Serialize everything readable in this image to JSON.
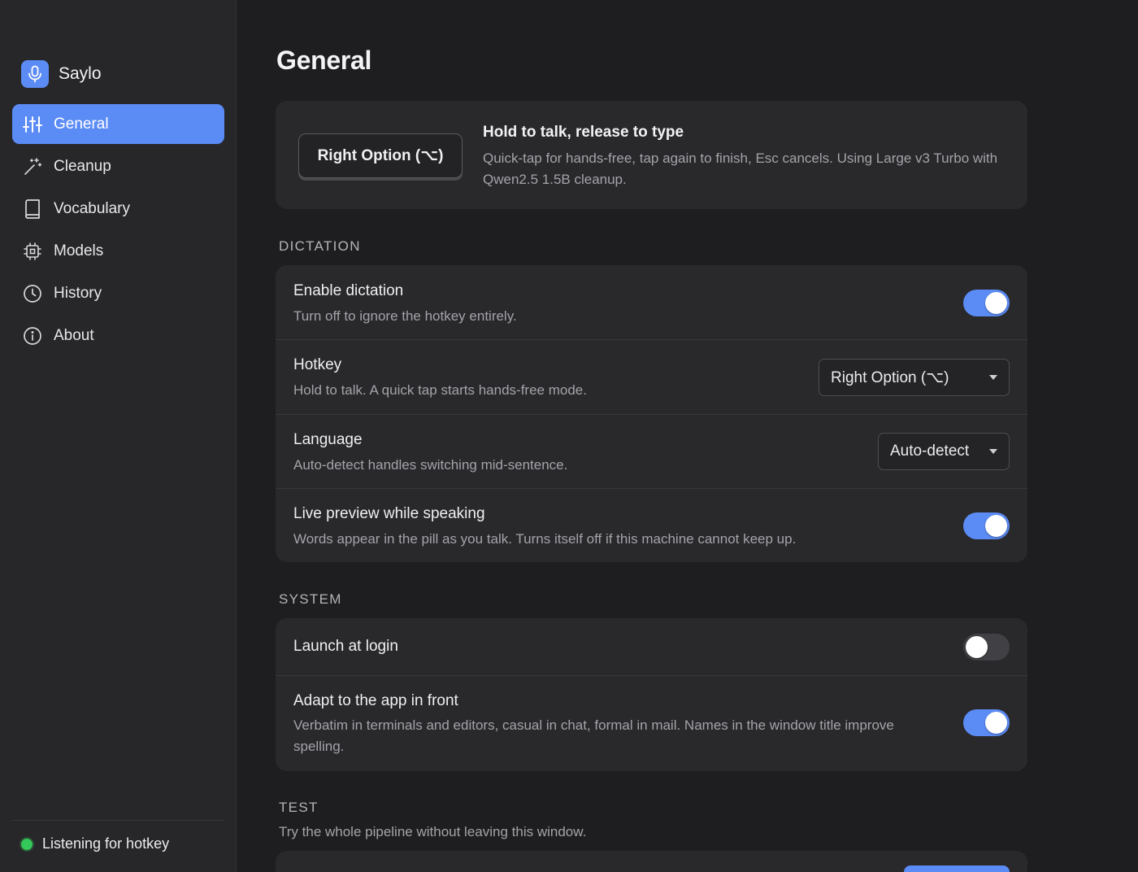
{
  "app": {
    "name": "Saylo"
  },
  "sidebar": {
    "items": [
      {
        "label": "General",
        "icon": "sliders-icon",
        "active": true
      },
      {
        "label": "Cleanup",
        "icon": "magic-wand-icon",
        "active": false
      },
      {
        "label": "Vocabulary",
        "icon": "book-icon",
        "active": false
      },
      {
        "label": "Models",
        "icon": "chip-icon",
        "active": false
      },
      {
        "label": "History",
        "icon": "clock-icon",
        "active": false
      },
      {
        "label": "About",
        "icon": "info-icon",
        "active": false
      }
    ],
    "status": {
      "text": "Listening for hotkey",
      "color": "#34c759"
    }
  },
  "page": {
    "title": "General"
  },
  "hero": {
    "key_label": "Right Option (⌥)",
    "title": "Hold to talk, release to type",
    "description": "Quick-tap for hands-free, tap again to finish, Esc cancels. Using Large v3 Turbo with Qwen2.5 1.5B cleanup."
  },
  "dictation": {
    "heading": "DICTATION",
    "enable": {
      "title": "Enable dictation",
      "desc": "Turn off to ignore the hotkey entirely.",
      "on": true
    },
    "hotkey": {
      "title": "Hotkey",
      "desc": "Hold to talk. A quick tap starts hands-free mode.",
      "value": "Right Option (⌥)"
    },
    "language": {
      "title": "Language",
      "desc": "Auto-detect handles switching mid-sentence.",
      "value": "Auto-detect"
    },
    "live_preview": {
      "title": "Live preview while speaking",
      "desc": "Words appear in the pill as you talk. Turns itself off if this machine cannot keep up.",
      "on": true
    }
  },
  "system": {
    "heading": "SYSTEM",
    "launch_at_login": {
      "title": "Launch at login",
      "on": false
    },
    "adapt": {
      "title": "Adapt to the app in front",
      "desc": "Verbatim in terminals and editors, casual in chat, formal in mail. Names in the window title improve spelling.",
      "on": true
    }
  },
  "test": {
    "heading": "TEST",
    "subtitle": "Try the whole pipeline without leaving this window."
  },
  "colors": {
    "accent": "#5b8bf5",
    "background": "#1e1e20",
    "sidebar": "#272729",
    "card": "#29292c",
    "status_green": "#34c759"
  }
}
